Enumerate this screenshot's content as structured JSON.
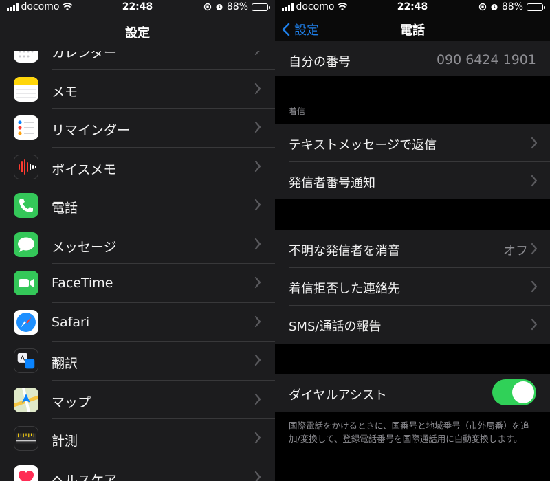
{
  "status": {
    "carrier": "docomo",
    "time": "22:48",
    "battery": "88%",
    "battery_level": 0.88
  },
  "settings": {
    "title": "設定",
    "items": [
      {
        "label": "カレンダー",
        "icon": "calendar-icon"
      },
      {
        "label": "メモ",
        "icon": "notes-icon"
      },
      {
        "label": "リマインダー",
        "icon": "reminders-icon"
      },
      {
        "label": "ボイスメモ",
        "icon": "voice-memos-icon"
      },
      {
        "label": "電話",
        "icon": "phone-icon"
      },
      {
        "label": "メッセージ",
        "icon": "messages-icon"
      },
      {
        "label": "FaceTime",
        "icon": "facetime-icon"
      },
      {
        "label": "Safari",
        "icon": "safari-icon"
      },
      {
        "label": "翻訳",
        "icon": "translate-icon"
      },
      {
        "label": "マップ",
        "icon": "maps-icon"
      },
      {
        "label": "計測",
        "icon": "measure-icon"
      },
      {
        "label": "ヘルスケア",
        "icon": "health-icon"
      }
    ]
  },
  "phone": {
    "back_label": "設定",
    "title": "電話",
    "my_number_label": "自分の番号",
    "my_number_value": "090 6424 1901",
    "calls_section_header": "着信",
    "reply_with_text": "テキストメッセージで返信",
    "caller_id": "発信者番号通知",
    "silence_unknown": "不明な発信者を消音",
    "silence_unknown_value": "オフ",
    "blocked_contacts": "着信拒否した連絡先",
    "sms_call_reporting": "SMS/通話の報告",
    "dial_assist": "ダイヤルアシスト",
    "dial_assist_on": true,
    "dial_assist_footer": "国際電話をかけるときに、国番号と地域番号（市外局番）を追加/変換して、登録電話番号を国際通話用に自動変換します。"
  },
  "colors": {
    "accent": "#1f7fe8",
    "toggle_on": "#30d158",
    "cell_bg": "#1c1c1e",
    "secondary_text": "#8e8e93"
  }
}
